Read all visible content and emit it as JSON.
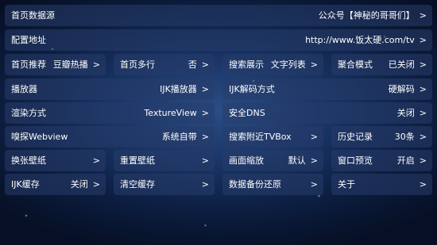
{
  "rows": [
    [
      {
        "label": "首页数据源",
        "value": "公众号【神秘的哥哥们】",
        "arrow": ">"
      }
    ],
    [
      {
        "label": "配置地址",
        "value": "http://www.饭太硬.com/tv",
        "arrow": ">"
      }
    ],
    [
      {
        "label": "首页推荐",
        "value": "豆瓣热播",
        "arrow": ">"
      },
      {
        "label": "首页多行",
        "value": "否",
        "arrow": ">"
      },
      {
        "label": "搜索展示",
        "value": "文字列表",
        "arrow": ">"
      },
      {
        "label": "聚合模式",
        "value": "已关闭",
        "arrow": ">"
      }
    ],
    [
      {
        "label": "播放器",
        "value": "IJK播放器",
        "arrow": ">"
      },
      {
        "label": "IJK解码方式",
        "value": "硬解码",
        "arrow": ">"
      }
    ],
    [
      {
        "label": "渲染方式",
        "value": "TextureView",
        "arrow": ">"
      },
      {
        "label": "安全DNS",
        "value": "关闭",
        "arrow": ">"
      }
    ],
    [
      {
        "label": "嗅探Webview",
        "value": "系统自带",
        "arrow": ">"
      },
      {
        "label": "搜索附近TVBox",
        "value": "",
        "arrow": ">"
      },
      {
        "label": "历史记录",
        "value": "30条",
        "arrow": ">"
      }
    ],
    [
      {
        "label": "换张壁纸",
        "value": "",
        "arrow": ">"
      },
      {
        "label": "重置壁纸",
        "value": "",
        "arrow": ">"
      },
      {
        "label": "画面缩放",
        "value": "默认",
        "arrow": ">"
      },
      {
        "label": "窗口预览",
        "value": "开启",
        "arrow": ">"
      }
    ],
    [
      {
        "label": "IJK缓存",
        "value": "关闭",
        "arrow": ">"
      },
      {
        "label": "清空缓存",
        "value": "",
        "arrow": ">"
      },
      {
        "label": "数据备份还原",
        "value": "",
        "arrow": ">"
      },
      {
        "label": "关于",
        "value": "",
        "arrow": ">"
      }
    ]
  ]
}
